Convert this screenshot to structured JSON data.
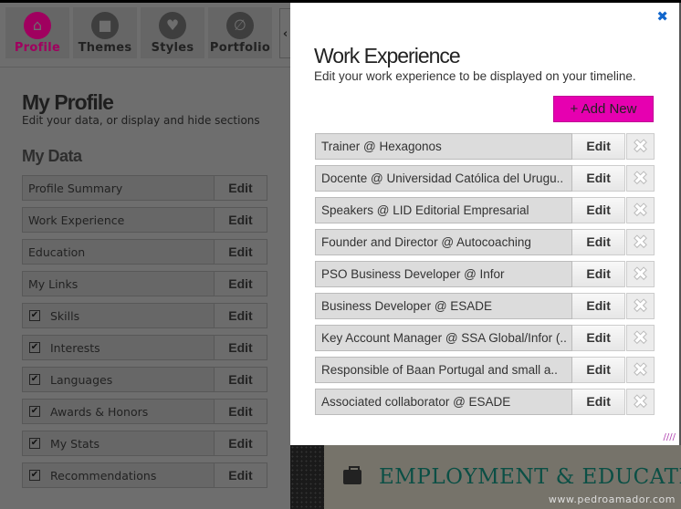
{
  "tabs": [
    {
      "label": "Profile",
      "icon": "home-icon",
      "active": true
    },
    {
      "label": "Themes",
      "icon": "briefcase-icon"
    },
    {
      "label": "Styles",
      "icon": "heart-icon"
    },
    {
      "label": "Portfolio",
      "icon": "paperclip-icon"
    }
  ],
  "profile": {
    "title": "My Profile",
    "subtitle": "Edit your data, or display and hide sections",
    "section": "My Data",
    "edit_label": "Edit",
    "items": [
      {
        "label": "Profile Summary",
        "checkbox": false
      },
      {
        "label": "Work Experience",
        "checkbox": false
      },
      {
        "label": "Education",
        "checkbox": false
      },
      {
        "label": "My Links",
        "checkbox": false
      },
      {
        "label": "Skills",
        "checkbox": true
      },
      {
        "label": "Interests",
        "checkbox": true
      },
      {
        "label": "Languages",
        "checkbox": true
      },
      {
        "label": "Awards & Honors",
        "checkbox": true
      },
      {
        "label": "My Stats",
        "checkbox": true
      },
      {
        "label": "Recommendations",
        "checkbox": true
      }
    ]
  },
  "modal": {
    "title": "Work Experience",
    "subtitle": "Edit your work experience to be displayed on your timeline.",
    "add_label": "+ Add New",
    "edit_label": "Edit",
    "items": [
      "Trainer @ Hexagonos",
      "Docente @ Universidad Católica del Urugu..",
      "Speakers @ LID Editorial Empresarial",
      "Founder and Director @ Autocoaching",
      "PSO Business Developer @ Infor",
      "Business Developer @ ESADE",
      "Key Account Manager @ SSA Global/Infor (..",
      "Responsible of Baan Portugal and small a..",
      "Associated collaborator @ ESADE"
    ]
  },
  "background": {
    "heading": "EMPLOYMENT & EDUCATIO",
    "watermark": "www.pedroamador.com"
  },
  "colors": {
    "accent": "#e600b0",
    "profile_active": "#a0005f",
    "heading": "#0b4f45",
    "close": "#1166cc"
  }
}
